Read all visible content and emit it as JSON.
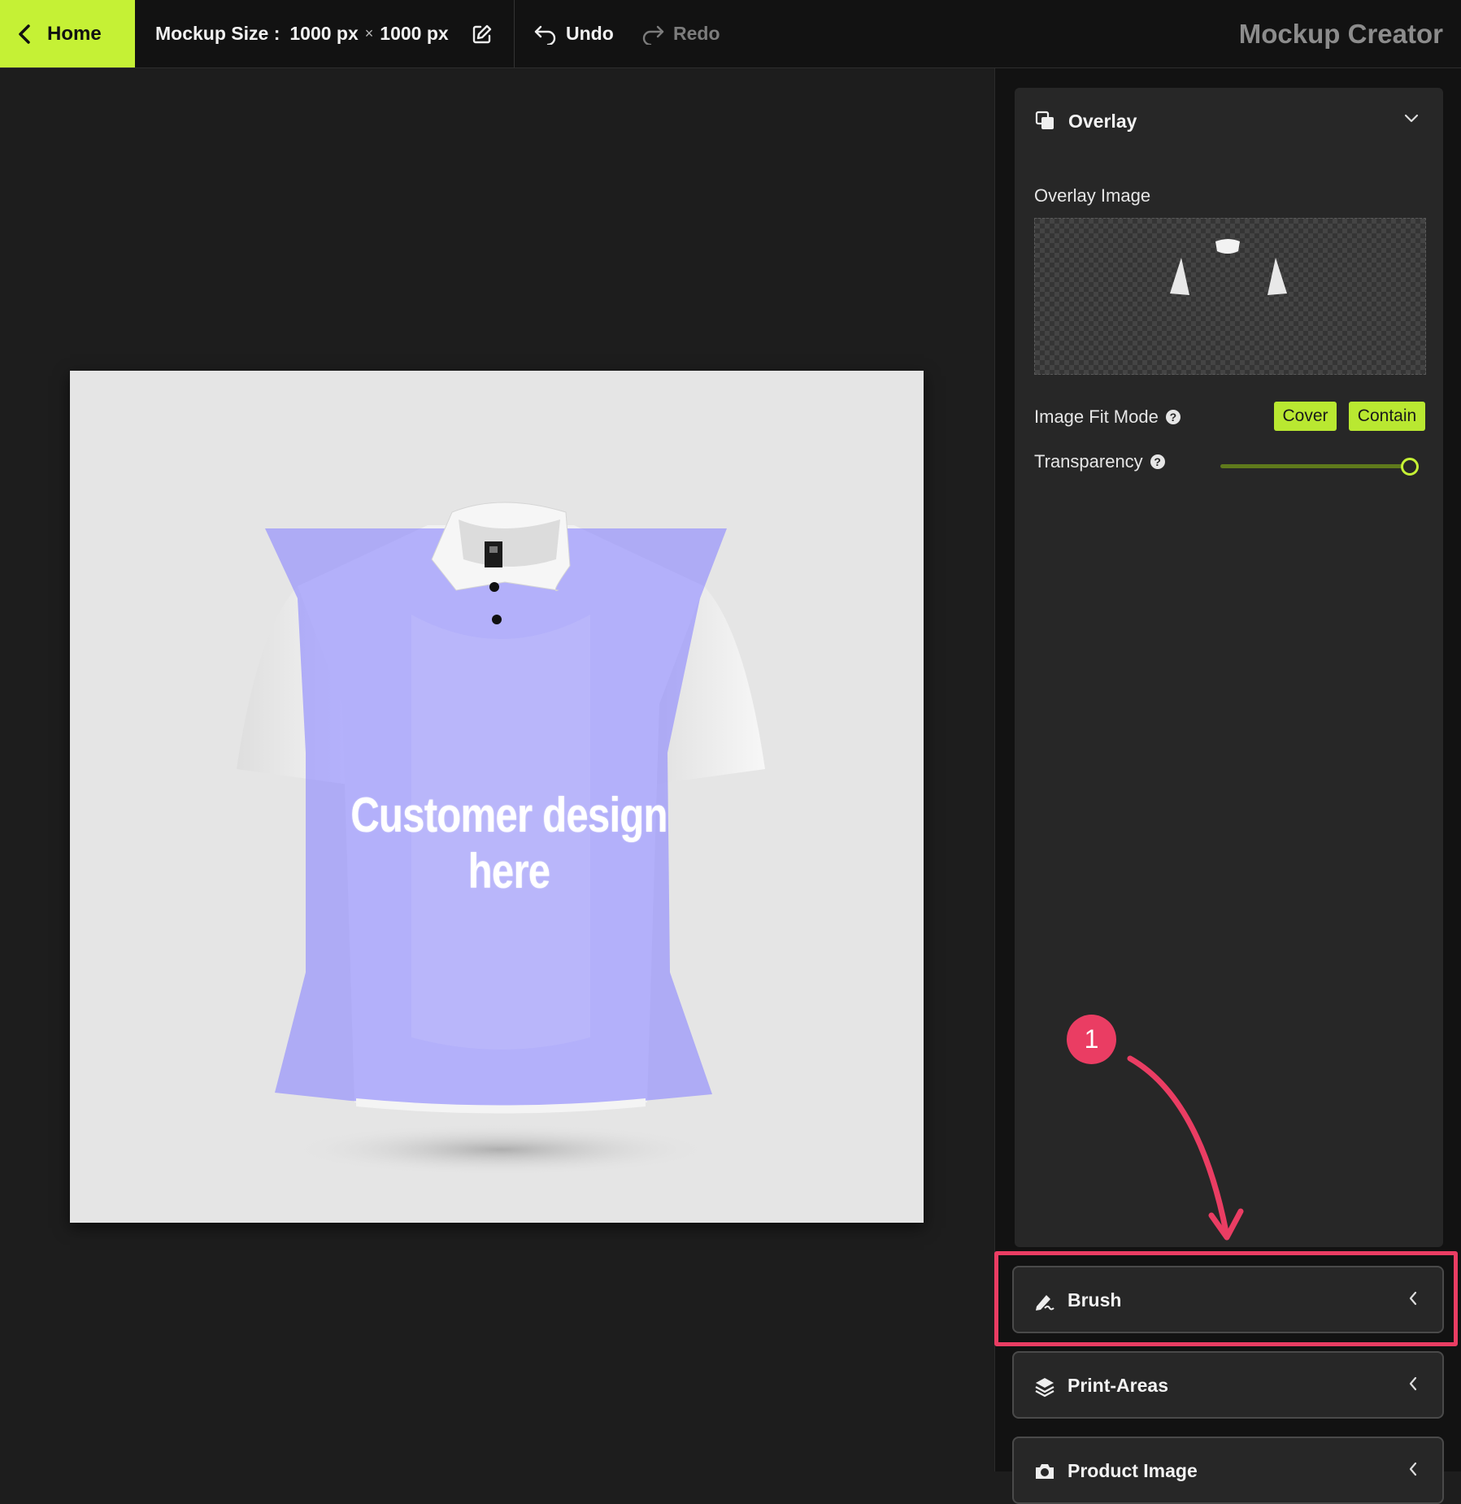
{
  "topbar": {
    "home_label": "Home",
    "mockup_size_label": "Mockup Size :",
    "width_value": "1000 px",
    "times": "×",
    "height_value": "1000 px",
    "undo_label": "Undo",
    "redo_label": "Redo",
    "app_title": "Mockup Creator"
  },
  "canvas": {
    "design_placeholder": "Customer design here",
    "shirt_color": "#ffffff",
    "print_area_color": "#a9a6ff"
  },
  "overlay_panel": {
    "title": "Overlay",
    "image_label": "Overlay Image",
    "fit_mode_label": "Image Fit Mode",
    "fit_options": [
      "Cover",
      "Contain"
    ],
    "transparency_label": "Transparency",
    "transparency_value": 1.0
  },
  "collapsed_panels": [
    {
      "title": "Brush",
      "icon": "brush-icon"
    },
    {
      "title": "Print-Areas",
      "icon": "layers-icon"
    },
    {
      "title": "Product Image",
      "icon": "camera-icon"
    }
  ],
  "annotation": {
    "step_number": "1",
    "color": "#ea3d63"
  },
  "colors": {
    "accent": "#c5f135",
    "background": "#1d1d1d",
    "panel": "#272727"
  }
}
